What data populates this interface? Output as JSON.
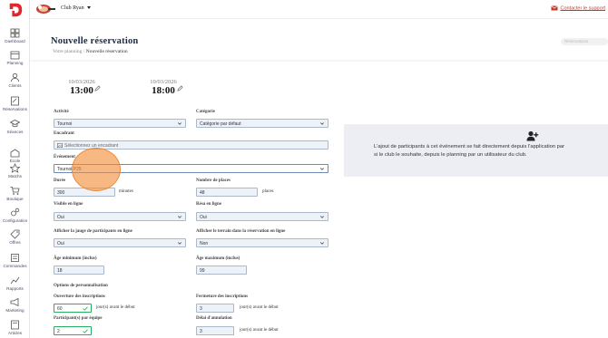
{
  "topbar": {
    "club_name": "Club Ryan",
    "support_label": "Contacter le support"
  },
  "sidebar": {
    "items": [
      {
        "label": "Dashboard",
        "icon": "dashboard-icon"
      },
      {
        "label": "Planning",
        "icon": "calendar-icon"
      },
      {
        "label": "Clients",
        "icon": "clients-icon"
      },
      {
        "label": "Réservations",
        "icon": "reservations-icon"
      },
      {
        "label": "Séances",
        "icon": "graduation-icon"
      },
      {
        "label": "École",
        "icon": "school-icon"
      },
      {
        "label": "Matchs",
        "icon": "star-icon"
      },
      {
        "label": "Boutique",
        "icon": "cart-icon"
      },
      {
        "label": "Configuration",
        "icon": "gears-icon"
      },
      {
        "label": "Offres",
        "icon": "tag-icon"
      },
      {
        "label": "Commandes",
        "icon": "orders-icon"
      },
      {
        "label": "Rapports",
        "icon": "chart-icon"
      },
      {
        "label": "Marketing",
        "icon": "megaphone-icon"
      },
      {
        "label": "Articles",
        "icon": "articles-icon"
      }
    ]
  },
  "page": {
    "title": "Nouvelle réservation",
    "breadcrumb_parent": "Votre planning /",
    "breadcrumb_current": "Nouvelle réservation",
    "reservations_pill": "Réservations"
  },
  "datetime": {
    "start_date": "10/03/2026",
    "start_time": "13:00",
    "end_date": "10/03/2026",
    "end_time": "18:00"
  },
  "form": {
    "activite_label": "Activité",
    "activite_value": "Tournoi",
    "categorie_label": "Catégorie",
    "categorie_value": "Catégorie par défaut",
    "encadrant_label": "Encadrant",
    "encadrant_placeholder": "Sélectionnez un encadrant",
    "evenement_label": "Événement",
    "evenement_value": "Tournoi P25",
    "duree_label": "Durée",
    "duree_value": "300",
    "duree_suffix": "minutes",
    "places_label": "Nombre de places",
    "places_value": "48",
    "places_suffix": "places",
    "visible_label": "Visible en ligne",
    "visible_value": "Oui",
    "resa_label": "Résa en ligne",
    "resa_value": "Oui",
    "jauge_label": "Afficher la jauge de participants en ligne",
    "jauge_value": "Oui",
    "terrain_label": "Afficher le terrain dans la réservation en ligne",
    "terrain_value": "Non",
    "age_min_label": "Âge minimum (inclus)",
    "age_min_value": "18",
    "age_max_label": "Âge maximum (inclus)",
    "age_max_value": "99",
    "options_label": "Options de personnalisation",
    "ouverture_label": "Ouverture des inscriptions",
    "ouverture_value": "60",
    "ouverture_suffix": "jour(s) avant le début",
    "fermeture_label": "Fermeture des inscriptions",
    "fermeture_value": "3",
    "fermeture_suffix": "jour(s) avant le début",
    "participants_label": "Participant(s) par équipe",
    "participants_value": "2",
    "annulation_label": "Délai d'annulation",
    "annulation_value": "3",
    "annulation_suffix": "jour(s) avant le début"
  },
  "info_panel": {
    "line1": "L'ajout de participants à cet événement se fait directement depuis l'application par",
    "line2": "si le club le souhaite, depuis le planning par un utilisateur du club."
  },
  "colors": {
    "brand_red": "#e3262b",
    "input_bg": "#edf2f9",
    "highlight": "#f28c37",
    "title_navy": "#1c2a48"
  }
}
